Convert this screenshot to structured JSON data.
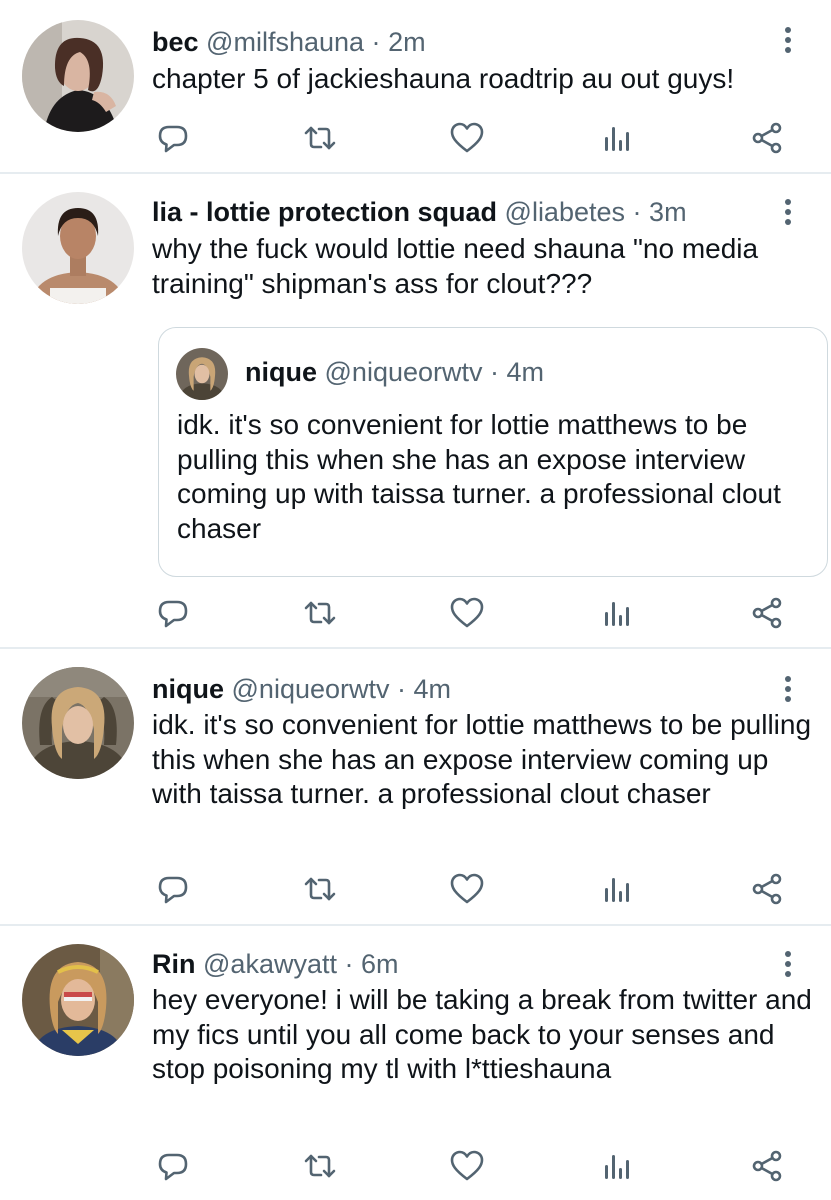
{
  "tweets": [
    {
      "name": "bec",
      "handle": "@milfshauna",
      "sep": "·",
      "time": "2m",
      "text": "chapter 5 of jackieshauna roadtrip au out guys!"
    },
    {
      "name": "lia - lottie protection squad",
      "handle": "@liabetes",
      "sep": "·",
      "time": "3m",
      "text": "why the fuck would lottie need shauna \"no media training\" shipman's ass for clout???",
      "quote": {
        "name": "nique",
        "handle": "@niqueorwtv",
        "sep": "·",
        "time": "4m",
        "text": "idk. it's so convenient for lottie matthews to be pulling this when she has an expose interview coming up with taissa turner. a professional clout chaser"
      }
    },
    {
      "name": "nique",
      "handle": "@niqueorwtv",
      "sep": "·",
      "time": "4m",
      "text": "idk. it's so convenient for lottie matthews to be pulling this when she has an expose interview coming up with taissa turner. a professional clout chaser"
    },
    {
      "name": "Rin",
      "handle": "@akawyatt",
      "sep": "·",
      "time": "6m",
      "text": "hey everyone! i will be taking a break from twitter and my fics until you all come back to your senses and stop poisoning my tl with l*ttieshauna"
    }
  ],
  "icons": {
    "reply": "reply-icon",
    "retweet": "retweet-icon",
    "like": "like-icon",
    "views": "views-icon",
    "share": "share-icon",
    "more": "more-icon"
  },
  "colors": {
    "text": "#0f1419",
    "secondary": "#536471",
    "border": "#cfd9de",
    "separator": "#e6ecf0"
  }
}
